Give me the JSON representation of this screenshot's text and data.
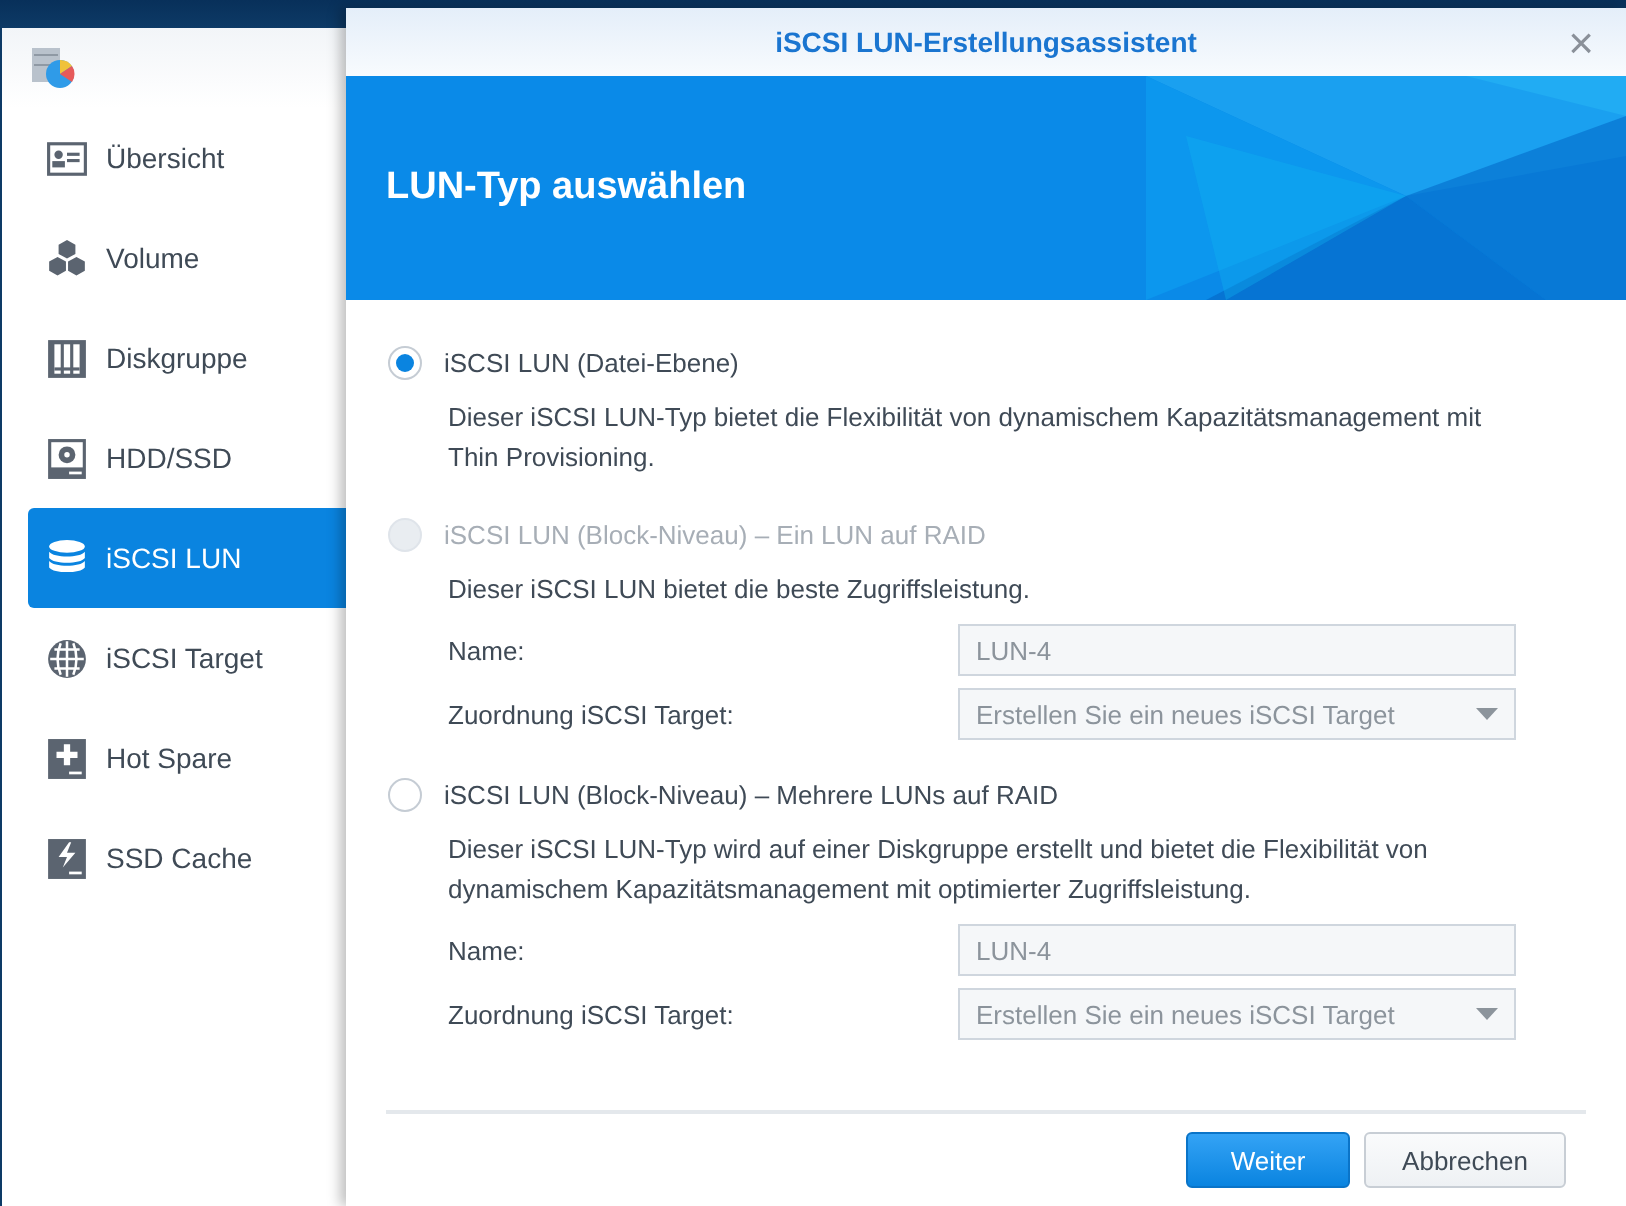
{
  "sidebar": {
    "items": [
      {
        "label": "Übersicht",
        "kind": "overview",
        "selected": false
      },
      {
        "label": "Volume",
        "kind": "volume",
        "selected": false
      },
      {
        "label": "Diskgruppe",
        "kind": "diskgroup",
        "selected": false
      },
      {
        "label": "HDD/SSD",
        "kind": "drive",
        "selected": false
      },
      {
        "label": "iSCSI LUN",
        "kind": "lun",
        "selected": true
      },
      {
        "label": "iSCSI Target",
        "kind": "target",
        "selected": false
      },
      {
        "label": "Hot Spare",
        "kind": "spare",
        "selected": false
      },
      {
        "label": "SSD Cache",
        "kind": "cache",
        "selected": false
      }
    ]
  },
  "dialog": {
    "title": "iSCSI LUN-Erstellungsassistent",
    "close": "×",
    "heading": "LUN-Typ auswählen",
    "options": [
      {
        "label": "iSCSI LUN (Datei-Ebene)",
        "selected": true,
        "disabled": false,
        "description": "Dieser iSCSI LUN-Typ bietet die Flexibilität von dynamischem Kapazitätsmanagement mit Thin Provisioning."
      },
      {
        "label": "iSCSI LUN (Block-Niveau) – Ein LUN auf RAID",
        "selected": false,
        "disabled": true,
        "description": "Dieser iSCSI LUN bietet die beste Zugriffsleistung.",
        "fields": [
          {
            "kind": "text",
            "label": "Name:",
            "value": "LUN-4",
            "disabled": true
          },
          {
            "kind": "select",
            "label": "Zuordnung iSCSI Target:",
            "value": "Erstellen Sie ein neues iSCSI Target",
            "disabled": true
          }
        ]
      },
      {
        "label": "iSCSI LUN (Block-Niveau) – Mehrere LUNs auf RAID",
        "selected": false,
        "disabled": false,
        "description": "Dieser iSCSI LUN-Typ wird auf einer Diskgruppe erstellt und bietet die Flexibilität von dynamischem Kapazitätsmanagement mit optimierter Zugriffsleistung.",
        "fields": [
          {
            "kind": "text",
            "label": "Name:",
            "value": "LUN-4",
            "disabled": true
          },
          {
            "kind": "select",
            "label": "Zuordnung iSCSI Target:",
            "value": "Erstellen Sie ein neues iSCSI Target",
            "disabled": true
          }
        ]
      }
    ],
    "buttons": [
      {
        "label": "Weiter",
        "kind": "primary"
      },
      {
        "label": "Abbrechen",
        "kind": "secondary"
      }
    ]
  }
}
